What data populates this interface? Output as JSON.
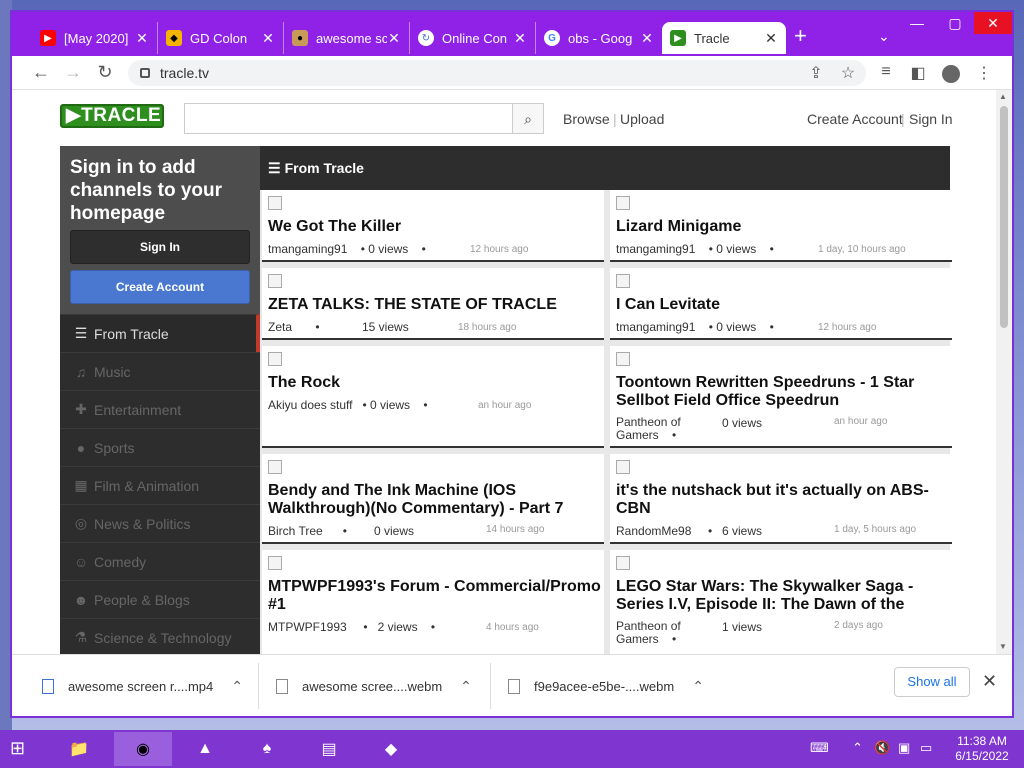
{
  "browser": {
    "tabs": [
      {
        "label": "[May 2020]",
        "icon": "youtube-icon"
      },
      {
        "label": "GD Colon",
        "icon": "gd-icon"
      },
      {
        "label": "awesome sc",
        "icon": "pug-icon"
      },
      {
        "label": "Online Con",
        "icon": "convert-icon"
      },
      {
        "label": "obs - Goog",
        "icon": "google-icon"
      },
      {
        "label": "Tracle",
        "icon": "tracle-icon"
      }
    ],
    "url": "tracle.tv",
    "accent": "#8f22e6"
  },
  "site": {
    "logo": "▶TRACLE",
    "nav": {
      "browse": "Browse",
      "upload": "Upload",
      "create_account": "Create Account",
      "sign_in": "Sign In"
    },
    "sidebar": {
      "prompt": "Sign in to add channels to your homepage",
      "sign_in": "Sign In",
      "create_account": "Create Account",
      "categories": [
        {
          "label": "From Tracle",
          "icon": "list-icon"
        },
        {
          "label": "Music",
          "icon": "headphones-icon"
        },
        {
          "label": "Entertainment",
          "icon": "gamepad-icon"
        },
        {
          "label": "Sports",
          "icon": "ball-icon"
        },
        {
          "label": "Film & Animation",
          "icon": "film-icon"
        },
        {
          "label": "News & Politics",
          "icon": "broadcast-icon"
        },
        {
          "label": "Comedy",
          "icon": "mask-icon"
        },
        {
          "label": "People & Blogs",
          "icon": "people-icon"
        },
        {
          "label": "Science & Technology",
          "icon": "flask-icon"
        }
      ]
    },
    "section_title": "From Tracle",
    "videos": [
      {
        "title": "We Got The Killer",
        "author": "tmangaming91",
        "views": "0 views",
        "ago": "12 hours ago"
      },
      {
        "title": "Lizard Minigame",
        "author": "tmangaming91",
        "views": "0 views",
        "ago": "1 day, 10 hours ago"
      },
      {
        "title": "ZETA TALKS: THE STATE OF TRACLE",
        "author": "Zeta",
        "views": "15 views",
        "ago": "18 hours ago"
      },
      {
        "title": "I Can Levitate",
        "author": "tmangaming91",
        "views": "0 views",
        "ago": "12 hours ago"
      },
      {
        "title": "The Rock",
        "author": "Akiyu does stuff",
        "views": "0 views",
        "ago": "an hour ago"
      },
      {
        "title": "Toontown Rewritten Speedruns - 1 Star Sellbot Field Office Speedrun",
        "author": "Pantheon of Gamers",
        "views": "0 views",
        "ago": "an hour ago"
      },
      {
        "title": "Bendy and The Ink Machine (IOS Walkthrough)(No Commentary) - Part 7",
        "author": "Birch Tree",
        "views": "0 views",
        "ago": "14 hours ago"
      },
      {
        "title": "it's the nutshack but it's actually on ABS-CBN",
        "author": "RandomMe98",
        "views": "6 views",
        "ago": "1 day, 5 hours ago"
      },
      {
        "title": "MTPWPF1993's Forum - Commercial/Promo #1",
        "author": "MTPWPF1993",
        "views": "2 views",
        "ago": "4 hours ago"
      },
      {
        "title": "LEGO Star Wars: The Skywalker Saga - Series I.V, Episode II: The Dawn of the Clone Wars",
        "author": "Pantheon of Gamers",
        "views": "1 views",
        "ago": "2 days ago"
      }
    ]
  },
  "downloads": {
    "items": [
      "awesome screen r....mp4",
      "awesome scree....webm",
      "f9e9acee-e5be-....webm"
    ],
    "show_all": "Show all"
  },
  "taskbar": {
    "time": "11:38 AM",
    "date": "6/15/2022"
  }
}
